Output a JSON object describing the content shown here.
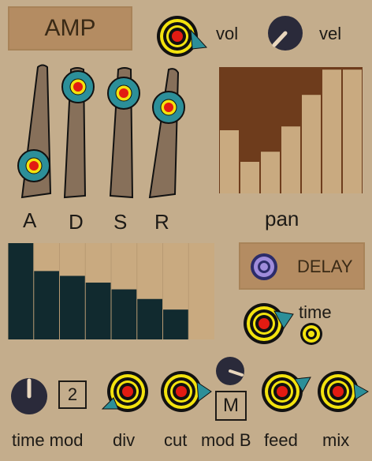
{
  "amp_panel": {
    "title": "AMP",
    "vol_label": "vol",
    "vel_label": "vel",
    "adsr_labels": [
      "A",
      "D",
      "S",
      "R"
    ],
    "adsr_levels": [
      0.2,
      0.85,
      0.85,
      0.75
    ],
    "pan_label": "pan",
    "pan_values": [
      0.5,
      0.25,
      0.33,
      0.53,
      0.78,
      0.98,
      0.98
    ]
  },
  "delay_panel": {
    "toggle_label": "DELAY",
    "time_label": "time",
    "steps_values": [
      1.0,
      0.71,
      0.66,
      0.59,
      0.52,
      0.42,
      0.31,
      0.0
    ]
  },
  "bottom_row": {
    "time_mod_label": "time mod",
    "time_mod_value": "2",
    "div_label": "div",
    "cut_label": "cut",
    "mod_b_label": "mod B",
    "mod_b_button": "M",
    "feed_label": "feed",
    "mix_label": "mix"
  },
  "colors": {
    "background": "#c4ad8c",
    "panel_button": "#b48c62",
    "pan_fill": "#6e3c1c",
    "steps_fill": "#112a2f",
    "knob_yellow": "#f3e30e",
    "knob_teal": "#2c8f99",
    "knob_red": "#e21b12",
    "dark_knob": "#2a2a3a"
  }
}
